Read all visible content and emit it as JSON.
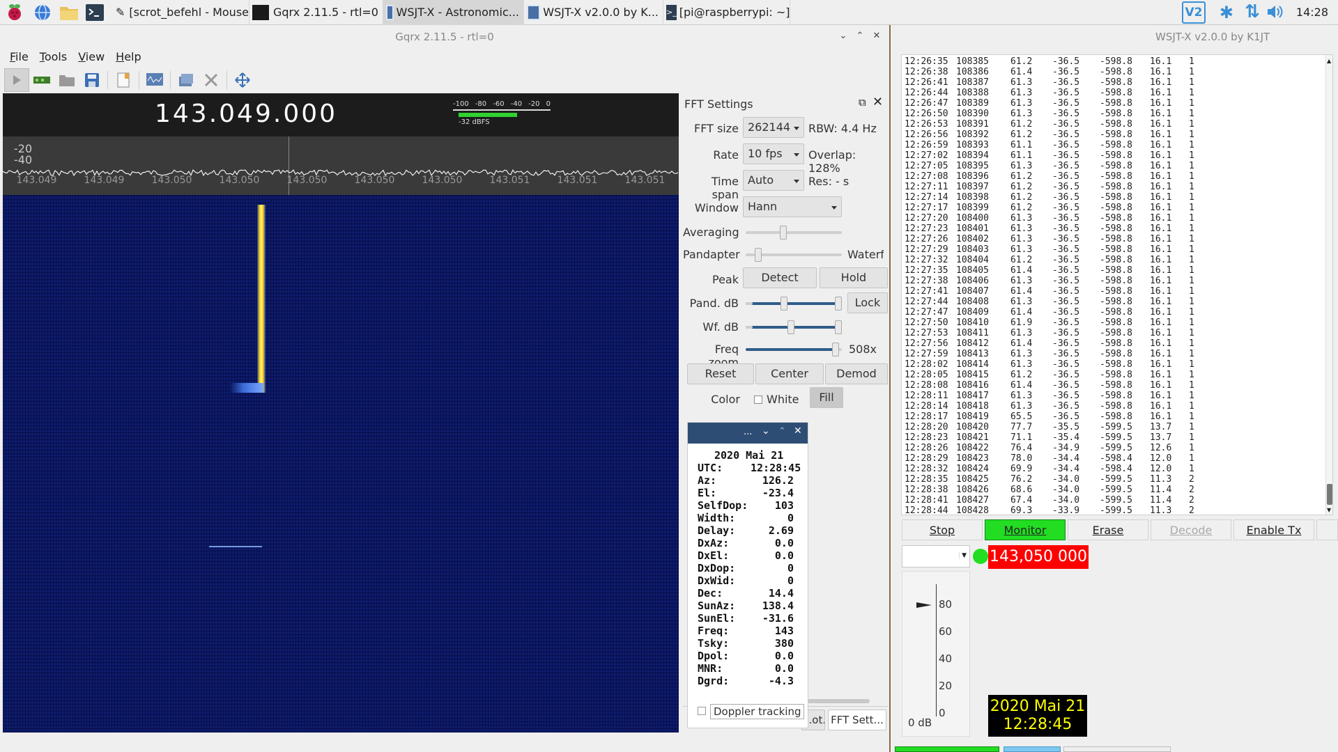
{
  "taskbar": {
    "tasks": [
      {
        "label": "[scrot_befehl - Mouse..."
      },
      {
        "label": "Gqrx 2.11.5 - rtl=0"
      },
      {
        "label": "WSJT-X - Astronomic..."
      },
      {
        "label": "WSJT-X   v2.0.0   by K..."
      },
      {
        "label": "[pi@raspberrypi: ~]"
      }
    ],
    "clock": "14:28",
    "tray_vnc": "V2"
  },
  "gqrx": {
    "title": "Gqrx 2.11.5 - rtl=0",
    "menu": [
      "File",
      "Tools",
      "View",
      "Help"
    ],
    "frequency": "143.049.000",
    "meter": {
      "ticks": [
        "-100",
        "-80",
        "-60",
        "-40",
        "-20",
        "0"
      ],
      "level": "-32 dBFS",
      "level_fraction": 0.68
    },
    "y_labels": [
      "-20",
      "-40"
    ],
    "x_labels": [
      "143.049",
      "143.049",
      "143.050",
      "143.050",
      "143.050",
      "143.050",
      "143.050",
      "143.051",
      "143.051",
      "143.051"
    ],
    "fft": {
      "title": "FFT Settings",
      "fft_size_label": "FFT size",
      "fft_size": "262144",
      "rbw": "RBW: 4.4 Hz",
      "rate_label": "Rate",
      "rate": "10 fps",
      "overlap": "Overlap: 128%",
      "span_label": "Time span",
      "span": "Auto",
      "res": "Res: - s",
      "window_label": "Window",
      "window": "Hann",
      "averaging_label": "Averaging",
      "averaging": 0.38,
      "pandapter_label": "Pandapter",
      "pandapter_right": "Waterfa",
      "pandapter": 0.1,
      "peak_label": "Peak",
      "detect": "Detect",
      "hold": "Hold",
      "pand_db_label": "Pand. dB",
      "lock": "Lock",
      "wf_db_label": "Wf. dB",
      "freq_zoom_label": "Freq zoom",
      "freq_zoom": "508x",
      "freq_zoom_level": 0.97,
      "reset": "Reset",
      "center": "Center",
      "demod": "Demod",
      "color_label": "Color",
      "white": "White",
      "fill": "Fill"
    },
    "bottom_tabs": [
      "...ot...",
      "FFT Sett..."
    ]
  },
  "astro": {
    "header": "...",
    "date": "2020 Mai 21",
    "rows": [
      {
        "k": "UTC:",
        "v": "12:28:45"
      },
      {
        "k": "Az:",
        "v": "126.2"
      },
      {
        "k": "El:",
        "v": "-23.4"
      },
      {
        "k": "SelfDop:",
        "v": "103"
      },
      {
        "k": "Width:",
        "v": "0"
      },
      {
        "k": "Delay:",
        "v": "2.69"
      },
      {
        "k": "DxAz:",
        "v": "0.0"
      },
      {
        "k": "DxEl:",
        "v": "0.0"
      },
      {
        "k": "DxDop:",
        "v": "0"
      },
      {
        "k": "DxWid:",
        "v": "0"
      },
      {
        "k": "Dec:",
        "v": "14.4"
      },
      {
        "k": "SunAz:",
        "v": "138.4"
      },
      {
        "k": "SunEl:",
        "v": "-31.6"
      },
      {
        "k": "Freq:",
        "v": "143"
      },
      {
        "k": "Tsky:",
        "v": "380"
      },
      {
        "k": "Dpol:",
        "v": "0.0"
      },
      {
        "k": "MNR:",
        "v": "0.0"
      },
      {
        "k": "Dgrd:",
        "v": "-4.3"
      }
    ],
    "doppler": "Doppler tracking"
  },
  "wsjt": {
    "title": "WSJT-X   v2.0.0   by K1JT",
    "log": [
      [
        "12:26:35",
        "108385",
        "61.2",
        "-36.5",
        "-598.8",
        "16.1",
        "1"
      ],
      [
        "12:26:38",
        "108386",
        "61.4",
        "-36.5",
        "-598.8",
        "16.1",
        "1"
      ],
      [
        "12:26:41",
        "108387",
        "61.3",
        "-36.5",
        "-598.8",
        "16.1",
        "1"
      ],
      [
        "12:26:44",
        "108388",
        "61.3",
        "-36.5",
        "-598.8",
        "16.1",
        "1"
      ],
      [
        "12:26:47",
        "108389",
        "61.3",
        "-36.5",
        "-598.8",
        "16.1",
        "1"
      ],
      [
        "12:26:50",
        "108390",
        "61.3",
        "-36.5",
        "-598.8",
        "16.1",
        "1"
      ],
      [
        "12:26:53",
        "108391",
        "61.2",
        "-36.5",
        "-598.8",
        "16.1",
        "1"
      ],
      [
        "12:26:56",
        "108392",
        "61.2",
        "-36.5",
        "-598.8",
        "16.1",
        "1"
      ],
      [
        "12:26:59",
        "108393",
        "61.1",
        "-36.5",
        "-598.8",
        "16.1",
        "1"
      ],
      [
        "12:27:02",
        "108394",
        "61.1",
        "-36.5",
        "-598.8",
        "16.1",
        "1"
      ],
      [
        "12:27:05",
        "108395",
        "61.3",
        "-36.5",
        "-598.8",
        "16.1",
        "1"
      ],
      [
        "12:27:08",
        "108396",
        "61.2",
        "-36.5",
        "-598.8",
        "16.1",
        "1"
      ],
      [
        "12:27:11",
        "108397",
        "61.2",
        "-36.5",
        "-598.8",
        "16.1",
        "1"
      ],
      [
        "12:27:14",
        "108398",
        "61.2",
        "-36.5",
        "-598.8",
        "16.1",
        "1"
      ],
      [
        "12:27:17",
        "108399",
        "61.2",
        "-36.5",
        "-598.8",
        "16.1",
        "1"
      ],
      [
        "12:27:20",
        "108400",
        "61.3",
        "-36.5",
        "-598.8",
        "16.1",
        "1"
      ],
      [
        "12:27:23",
        "108401",
        "61.3",
        "-36.5",
        "-598.8",
        "16.1",
        "1"
      ],
      [
        "12:27:26",
        "108402",
        "61.3",
        "-36.5",
        "-598.8",
        "16.1",
        "1"
      ],
      [
        "12:27:29",
        "108403",
        "61.3",
        "-36.5",
        "-598.8",
        "16.1",
        "1"
      ],
      [
        "12:27:32",
        "108404",
        "61.2",
        "-36.5",
        "-598.8",
        "16.1",
        "1"
      ],
      [
        "12:27:35",
        "108405",
        "61.4",
        "-36.5",
        "-598.8",
        "16.1",
        "1"
      ],
      [
        "12:27:38",
        "108406",
        "61.3",
        "-36.5",
        "-598.8",
        "16.1",
        "1"
      ],
      [
        "12:27:41",
        "108407",
        "61.4",
        "-36.5",
        "-598.8",
        "16.1",
        "1"
      ],
      [
        "12:27:44",
        "108408",
        "61.3",
        "-36.5",
        "-598.8",
        "16.1",
        "1"
      ],
      [
        "12:27:47",
        "108409",
        "61.4",
        "-36.5",
        "-598.8",
        "16.1",
        "1"
      ],
      [
        "12:27:50",
        "108410",
        "61.9",
        "-36.5",
        "-598.8",
        "16.1",
        "1"
      ],
      [
        "12:27:53",
        "108411",
        "61.3",
        "-36.5",
        "-598.8",
        "16.1",
        "1"
      ],
      [
        "12:27:56",
        "108412",
        "61.4",
        "-36.5",
        "-598.8",
        "16.1",
        "1"
      ],
      [
        "12:27:59",
        "108413",
        "61.3",
        "-36.5",
        "-598.8",
        "16.1",
        "1"
      ],
      [
        "12:28:02",
        "108414",
        "61.3",
        "-36.5",
        "-598.8",
        "16.1",
        "1"
      ],
      [
        "12:28:05",
        "108415",
        "61.2",
        "-36.5",
        "-598.8",
        "16.1",
        "1"
      ],
      [
        "12:28:08",
        "108416",
        "61.4",
        "-36.5",
        "-598.8",
        "16.1",
        "1"
      ],
      [
        "12:28:11",
        "108417",
        "61.3",
        "-36.5",
        "-598.8",
        "16.1",
        "1"
      ],
      [
        "12:28:14",
        "108418",
        "61.3",
        "-36.5",
        "-598.8",
        "16.1",
        "1"
      ],
      [
        "12:28:17",
        "108419",
        "65.5",
        "-36.5",
        "-598.8",
        "16.1",
        "1"
      ],
      [
        "12:28:20",
        "108420",
        "77.7",
        "-35.5",
        "-599.5",
        "13.7",
        "1"
      ],
      [
        "12:28:23",
        "108421",
        "71.1",
        "-35.4",
        "-599.5",
        "13.7",
        "1"
      ],
      [
        "12:28:26",
        "108422",
        "76.4",
        "-34.9",
        "-599.5",
        "12.6",
        "1"
      ],
      [
        "12:28:29",
        "108423",
        "78.0",
        "-34.4",
        "-598.4",
        "12.0",
        "1"
      ],
      [
        "12:28:32",
        "108424",
        "69.9",
        "-34.4",
        "-598.4",
        "12.0",
        "1"
      ],
      [
        "12:28:35",
        "108425",
        "76.2",
        "-34.0",
        "-599.5",
        "11.3",
        "2"
      ],
      [
        "12:28:38",
        "108426",
        "68.6",
        "-34.0",
        "-599.5",
        "11.4",
        "2"
      ],
      [
        "12:28:41",
        "108427",
        "67.4",
        "-34.0",
        "-599.5",
        "11.4",
        "2"
      ],
      [
        "12:28:44",
        "108428",
        "69.3",
        "-33.9",
        "-599.5",
        "11.3",
        "2"
      ]
    ],
    "buttons": {
      "stop": "Stop",
      "monitor": "Monitor",
      "erase": "Erase",
      "decode": "Decode",
      "enable_tx": "Enable Tx"
    },
    "dial": "143,050 000",
    "meter_ticks": [
      "80",
      "60",
      "40",
      "20",
      "0"
    ],
    "meter_db": "0 dB",
    "date": "2020 Mai 21",
    "time": "12:28:45"
  },
  "colors": {
    "monitor": "#22dd22",
    "dial_bg": "#ff0000",
    "clock_bg": "#000000",
    "clock_fg": "#ffff00",
    "waterfall": "#0c1a66"
  }
}
